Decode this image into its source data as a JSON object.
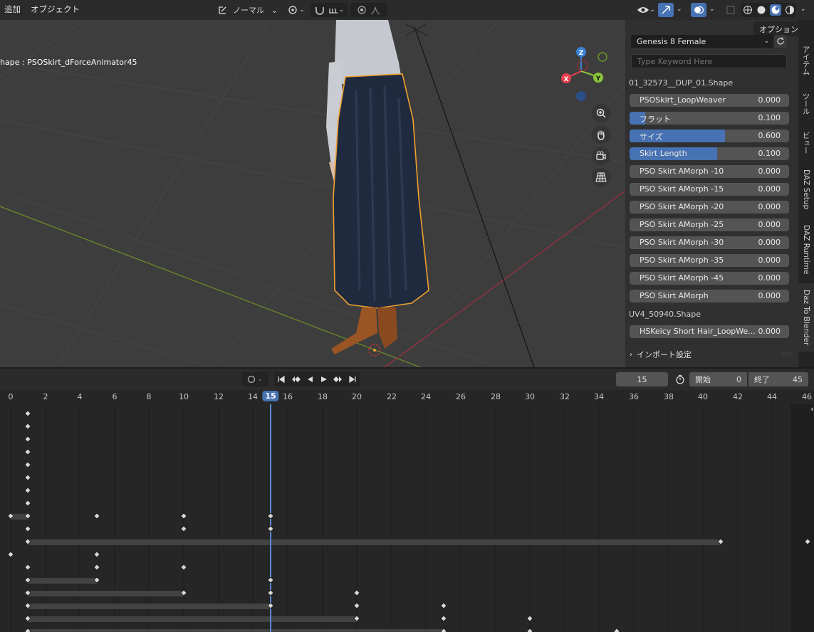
{
  "topbar": {
    "menu_add": "追加",
    "menu_object": "オブジェクト",
    "mode": "ノーマル",
    "options": "オプション"
  },
  "viewport": {
    "object_label": "hape : PSOSkirt_dForceAnimator45",
    "gizmo": {
      "x": "X",
      "y": "Y",
      "z": "Z"
    }
  },
  "panel": {
    "figure_select": "Genesis 8 Female",
    "search_placeholder": "Type Keyword Here",
    "group1_title": "01_32573__DUP_01.Shape",
    "group1_morphs": [
      {
        "label": "PSOSkirt_LoopWeaver",
        "value": "0.000",
        "fill": 0
      },
      {
        "label": "フラット",
        "value": "0.100",
        "fill": 0.1
      },
      {
        "label": "サイズ",
        "value": "0.600",
        "fill": 0.6
      },
      {
        "label": "Skirt Length",
        "value": "0.100",
        "fill": 0.55
      },
      {
        "label": "PSO Skirt AMorph -10",
        "value": "0.000",
        "fill": 0
      },
      {
        "label": "PSO Skirt AMorph -15",
        "value": "0.000",
        "fill": 0
      },
      {
        "label": "PSO Skirt AMorph -20",
        "value": "0.000",
        "fill": 0
      },
      {
        "label": "PSO Skirt AMorph -25",
        "value": "0.000",
        "fill": 0
      },
      {
        "label": "PSO Skirt AMorph -30",
        "value": "0.000",
        "fill": 0
      },
      {
        "label": "PSO Skirt AMorph -35",
        "value": "0.000",
        "fill": 0
      },
      {
        "label": "PSO Skirt AMorph -45",
        "value": "0.000",
        "fill": 0
      },
      {
        "label": "PSO Skirt AMorph",
        "value": "0.000",
        "fill": 0
      }
    ],
    "group2_title": "UV4_50940.Shape",
    "group2_morphs": [
      {
        "label": "HSKeicy Short Hair_LoopWe...",
        "value": "0.000",
        "fill": 0
      }
    ],
    "import_settings": "インポート設定"
  },
  "side_tabs": [
    "アイテム",
    "ツール",
    "ビュー",
    "DAZ Setup",
    "DAZ Runtime",
    "Daz To Blender"
  ],
  "timeline": {
    "current_frame": "15",
    "start_label": "開始",
    "start_value": "0",
    "end_label": "終了",
    "end_value": "45",
    "ruler_ticks": [
      "0",
      "2",
      "4",
      "6",
      "8",
      "10",
      "12",
      "14",
      "15",
      "16",
      "18",
      "20",
      "22",
      "24",
      "26",
      "28",
      "30",
      "32",
      "34",
      "36",
      "38",
      "40",
      "42",
      "44",
      "46"
    ]
  },
  "colors": {
    "accent": "#4772b3",
    "selection_outline": "#f0a030",
    "playhead": "#5a8ad8",
    "x_axis": "#e8404f",
    "y_axis": "#8cc43a",
    "z_axis": "#3b82d6"
  }
}
